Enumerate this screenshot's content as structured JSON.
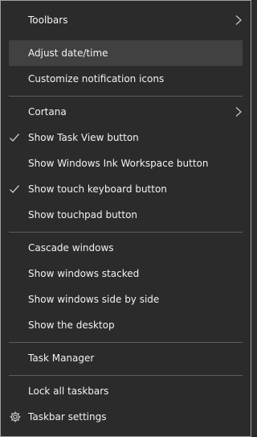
{
  "menu": {
    "toolbars": "Toolbars",
    "adjust_datetime": "Adjust date/time",
    "customize_notification_icons": "Customize notification icons",
    "cortana": "Cortana",
    "show_task_view": "Show Task View button",
    "show_ink_workspace": "Show Windows Ink Workspace button",
    "show_touch_keyboard": "Show touch keyboard button",
    "show_touchpad": "Show touchpad button",
    "cascade_windows": "Cascade windows",
    "show_windows_stacked": "Show windows stacked",
    "show_windows_side_by_side": "Show windows side by side",
    "show_desktop": "Show the desktop",
    "task_manager": "Task Manager",
    "lock_taskbars": "Lock all taskbars",
    "taskbar_settings": "Taskbar settings"
  },
  "state": {
    "show_task_view_checked": true,
    "show_touch_keyboard_checked": true,
    "hovered_item": "Adjust date/time"
  },
  "icons": {
    "submenu": "chevron-right-icon",
    "checked": "checkmark-icon",
    "settings": "gear-icon"
  },
  "colors": {
    "background": "#2b2b2b",
    "hover": "#414141",
    "text": "#f2f2f2",
    "separator": "#5c5c5c",
    "border": "#a0a0a0"
  }
}
